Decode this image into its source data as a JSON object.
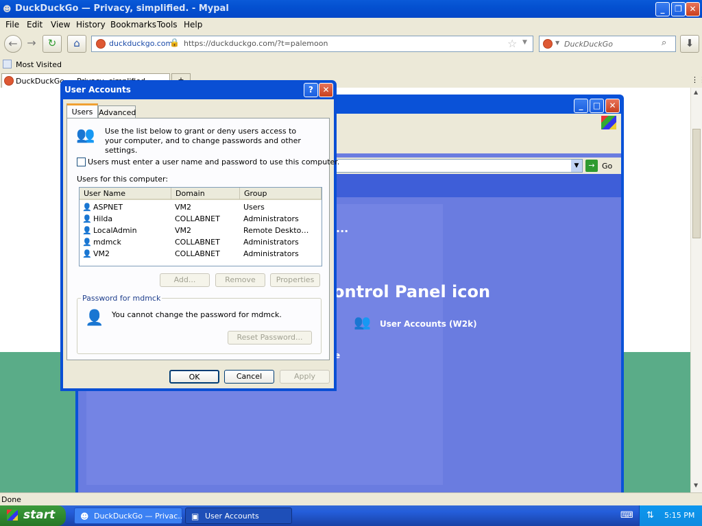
{
  "browser": {
    "window_title": "DuckDuckGo — Privacy, simplified. - Mypal",
    "menu": [
      "File",
      "Edit",
      "View",
      "History",
      "Bookmarks",
      "Tools",
      "Help"
    ],
    "url_site": "duckduckgo.com",
    "url": "https://duckduckgo.com/?t=palemoon",
    "search_placeholder": "DuckDuckGo",
    "bookmark": "Most Visited",
    "tab_title": "DuckDuckGo — Privacy, simplified.",
    "status": "Done"
  },
  "background_window": {
    "go_label": "Go",
    "ellipsis": "...",
    "heading_fragment": "ontrol Panel icon",
    "item_label": "User Accounts (W2k)",
    "fragment_e": "e"
  },
  "dialog": {
    "title": "User Accounts",
    "help_btn": "?",
    "close_btn": "✕",
    "tabs": [
      "Users",
      "Advanced"
    ],
    "intro": "Use the list below to grant or deny users access to your computer, and to change passwords and other settings.",
    "checkbox_label": "Users must enter a user name and password to use this computer.",
    "checkbox_checked": false,
    "list_label": "Users for this computer:",
    "columns": [
      "User Name",
      "Domain",
      "Group"
    ],
    "users": [
      {
        "name": "ASPNET",
        "domain": "VM2",
        "group": "Users"
      },
      {
        "name": "Hilda",
        "domain": "COLLABNET",
        "group": "Administrators"
      },
      {
        "name": "LocalAdmin",
        "domain": "VM2",
        "group": "Remote Deskto…"
      },
      {
        "name": "mdmck",
        "domain": "COLLABNET",
        "group": "Administrators"
      },
      {
        "name": "VM2",
        "domain": "COLLABNET",
        "group": "Administrators"
      }
    ],
    "buttons": {
      "add": "Add...",
      "remove": "Remove",
      "properties": "Properties"
    },
    "password_group": "Password for mdmck",
    "password_text": "You cannot change the password for mdmck.",
    "reset_btn": "Reset Password...",
    "ok": "OK",
    "cancel": "Cancel",
    "apply": "Apply"
  },
  "taskbar": {
    "start": "start",
    "tasks": [
      "DuckDuckGo — Privac...",
      "User Accounts"
    ],
    "clock": "5:15 PM"
  }
}
